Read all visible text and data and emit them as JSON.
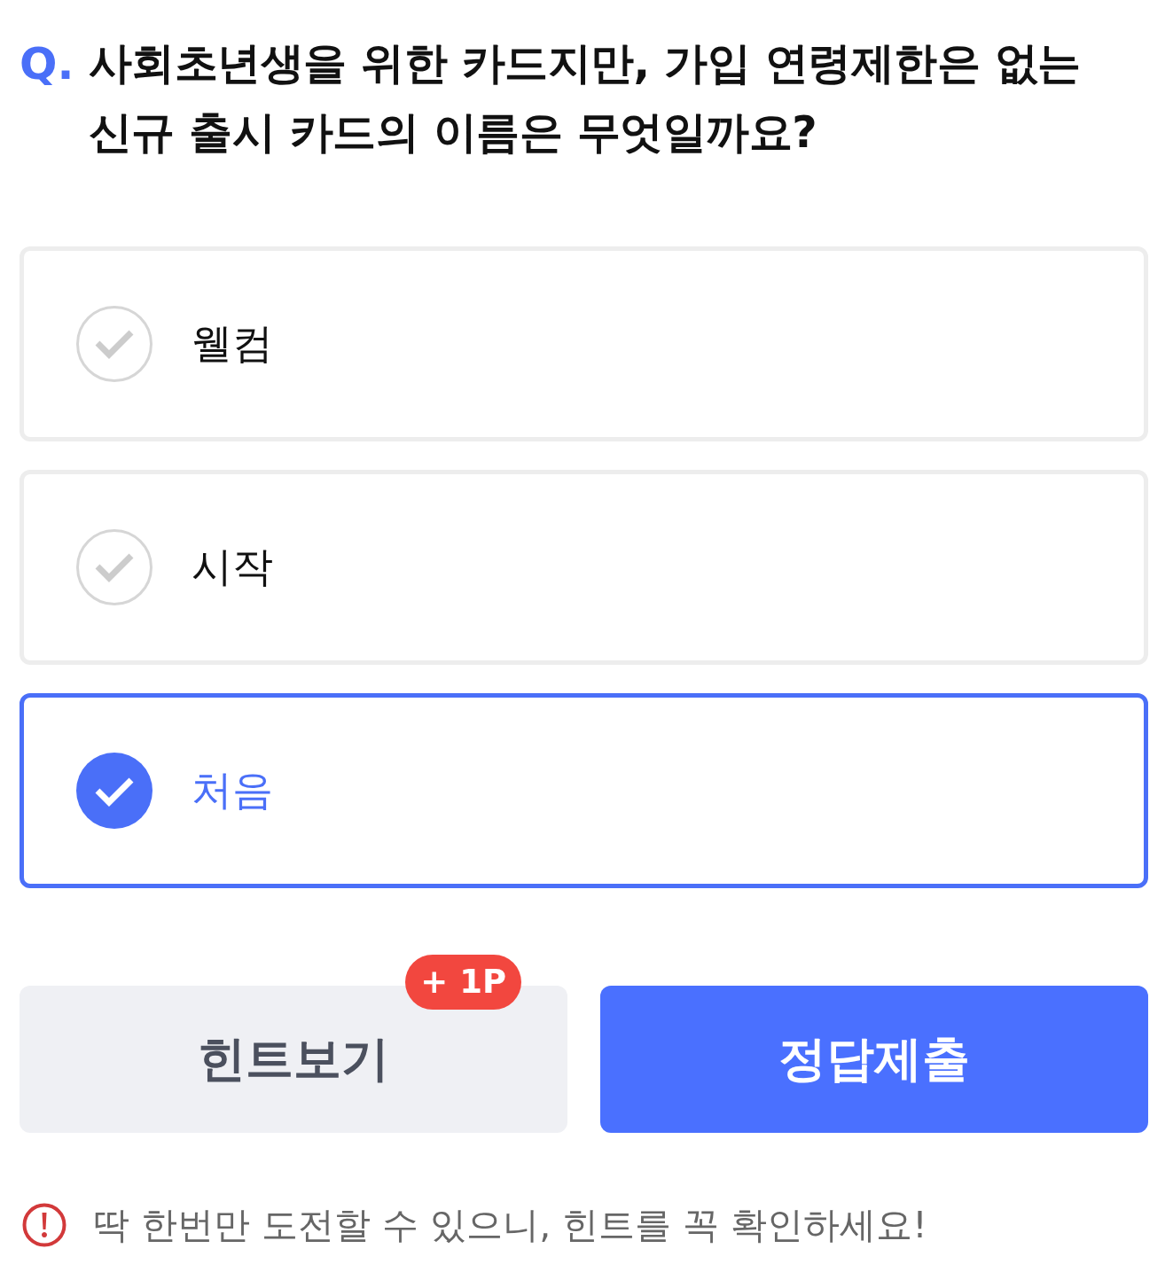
{
  "question": {
    "marker": "Q.",
    "text": "사회초년생을 위한 카드지만, 가입 연령제한은 없는\n신규 출시 카드의 이름은 무엇일까요?"
  },
  "options": [
    {
      "label": "웰컴",
      "selected": false
    },
    {
      "label": "시작",
      "selected": false
    },
    {
      "label": "처음",
      "selected": true
    }
  ],
  "buttons": [
    {
      "kind": "hint",
      "label": "힌트보기",
      "badge": "+ 1P"
    },
    {
      "kind": "submit",
      "label": "정답제출"
    }
  ],
  "notice": {
    "text": "딱 한번만 도전할 수 있으니, 힌트를 꼭 확인하세요!"
  }
}
